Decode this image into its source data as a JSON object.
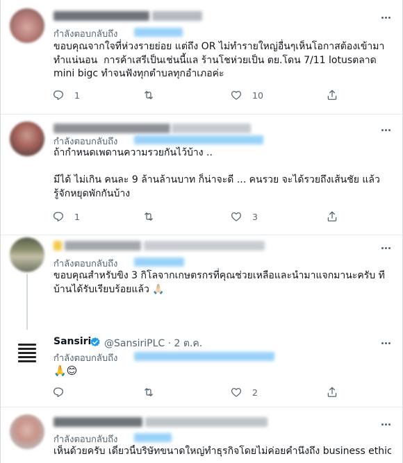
{
  "tweets": [
    {
      "reply_prefix": "กำลังตอบกลับถึง",
      "body": "ขอบคุณจากใจที่ห่วงรายย่อย แต่ถึง OR ไม่ทำรายใหญ่อื่นๆเห็นโอกาสต้องเข้ามาทำแน่นอน  การค้าเสรีเป็นเช่นนี้แล ร้านโชห่วยเป็น ตย.โดน 7/11 lotusตลาด mini bigc ทำจนฟังทุกตำบลทุกอำเภอค่ะ",
      "reply_count": "1",
      "retweet_count": "",
      "like_count": "10"
    },
    {
      "reply_prefix": "กำลังตอบกลับถึง",
      "body": "ถ้ากำหนดเพดานความรวยกันไว้บ้าง ..\n\nมีได้ ไม่เกิน คนละ 9 ล้านล้านบาท ก็น่าจะดี ... คนรวย จะได้รวยถึงเส้นชัย แล้วรู้จักหยุดพักกันบ้าง",
      "reply_count": "1",
      "retweet_count": "",
      "like_count": "3"
    },
    {
      "reply_prefix": "กำลังตอบกลับถึง",
      "body": "ขอบคุณสำหรับขิง 3 กิโลจากเกษตรกรที่คุณช่วยเหลือและนำมาแจกมานะครับ ทีบ้านได้รับเรียบร้อยแล้ว 🙏🏻"
    },
    {
      "author_name": "Sansiri",
      "author_handle": "@SansiriPLC · 2 ต.ค.",
      "reply_prefix": "กำลังตอบกลับถึง",
      "body": "🙏😊",
      "reply_count": "",
      "retweet_count": "",
      "like_count": "2"
    },
    {
      "reply_prefix": "กำลังตอบกลับถึง",
      "body": "เห็นด้วยครับ เดี๋ยวนี้บริษัทขนาดใหญ่ทำธุรกิจโดยไม่ค่อยคำนึงถึง business ethics"
    }
  ],
  "colors": {
    "link_blue": "#1d9bf0",
    "muted_gray": "#536471",
    "verified_blue": "#1d9bf0"
  },
  "icons": [
    "reply-icon",
    "retweet-icon",
    "like-icon",
    "share-icon",
    "more-icon",
    "verified-badge-icon",
    "sansiri-logo"
  ]
}
